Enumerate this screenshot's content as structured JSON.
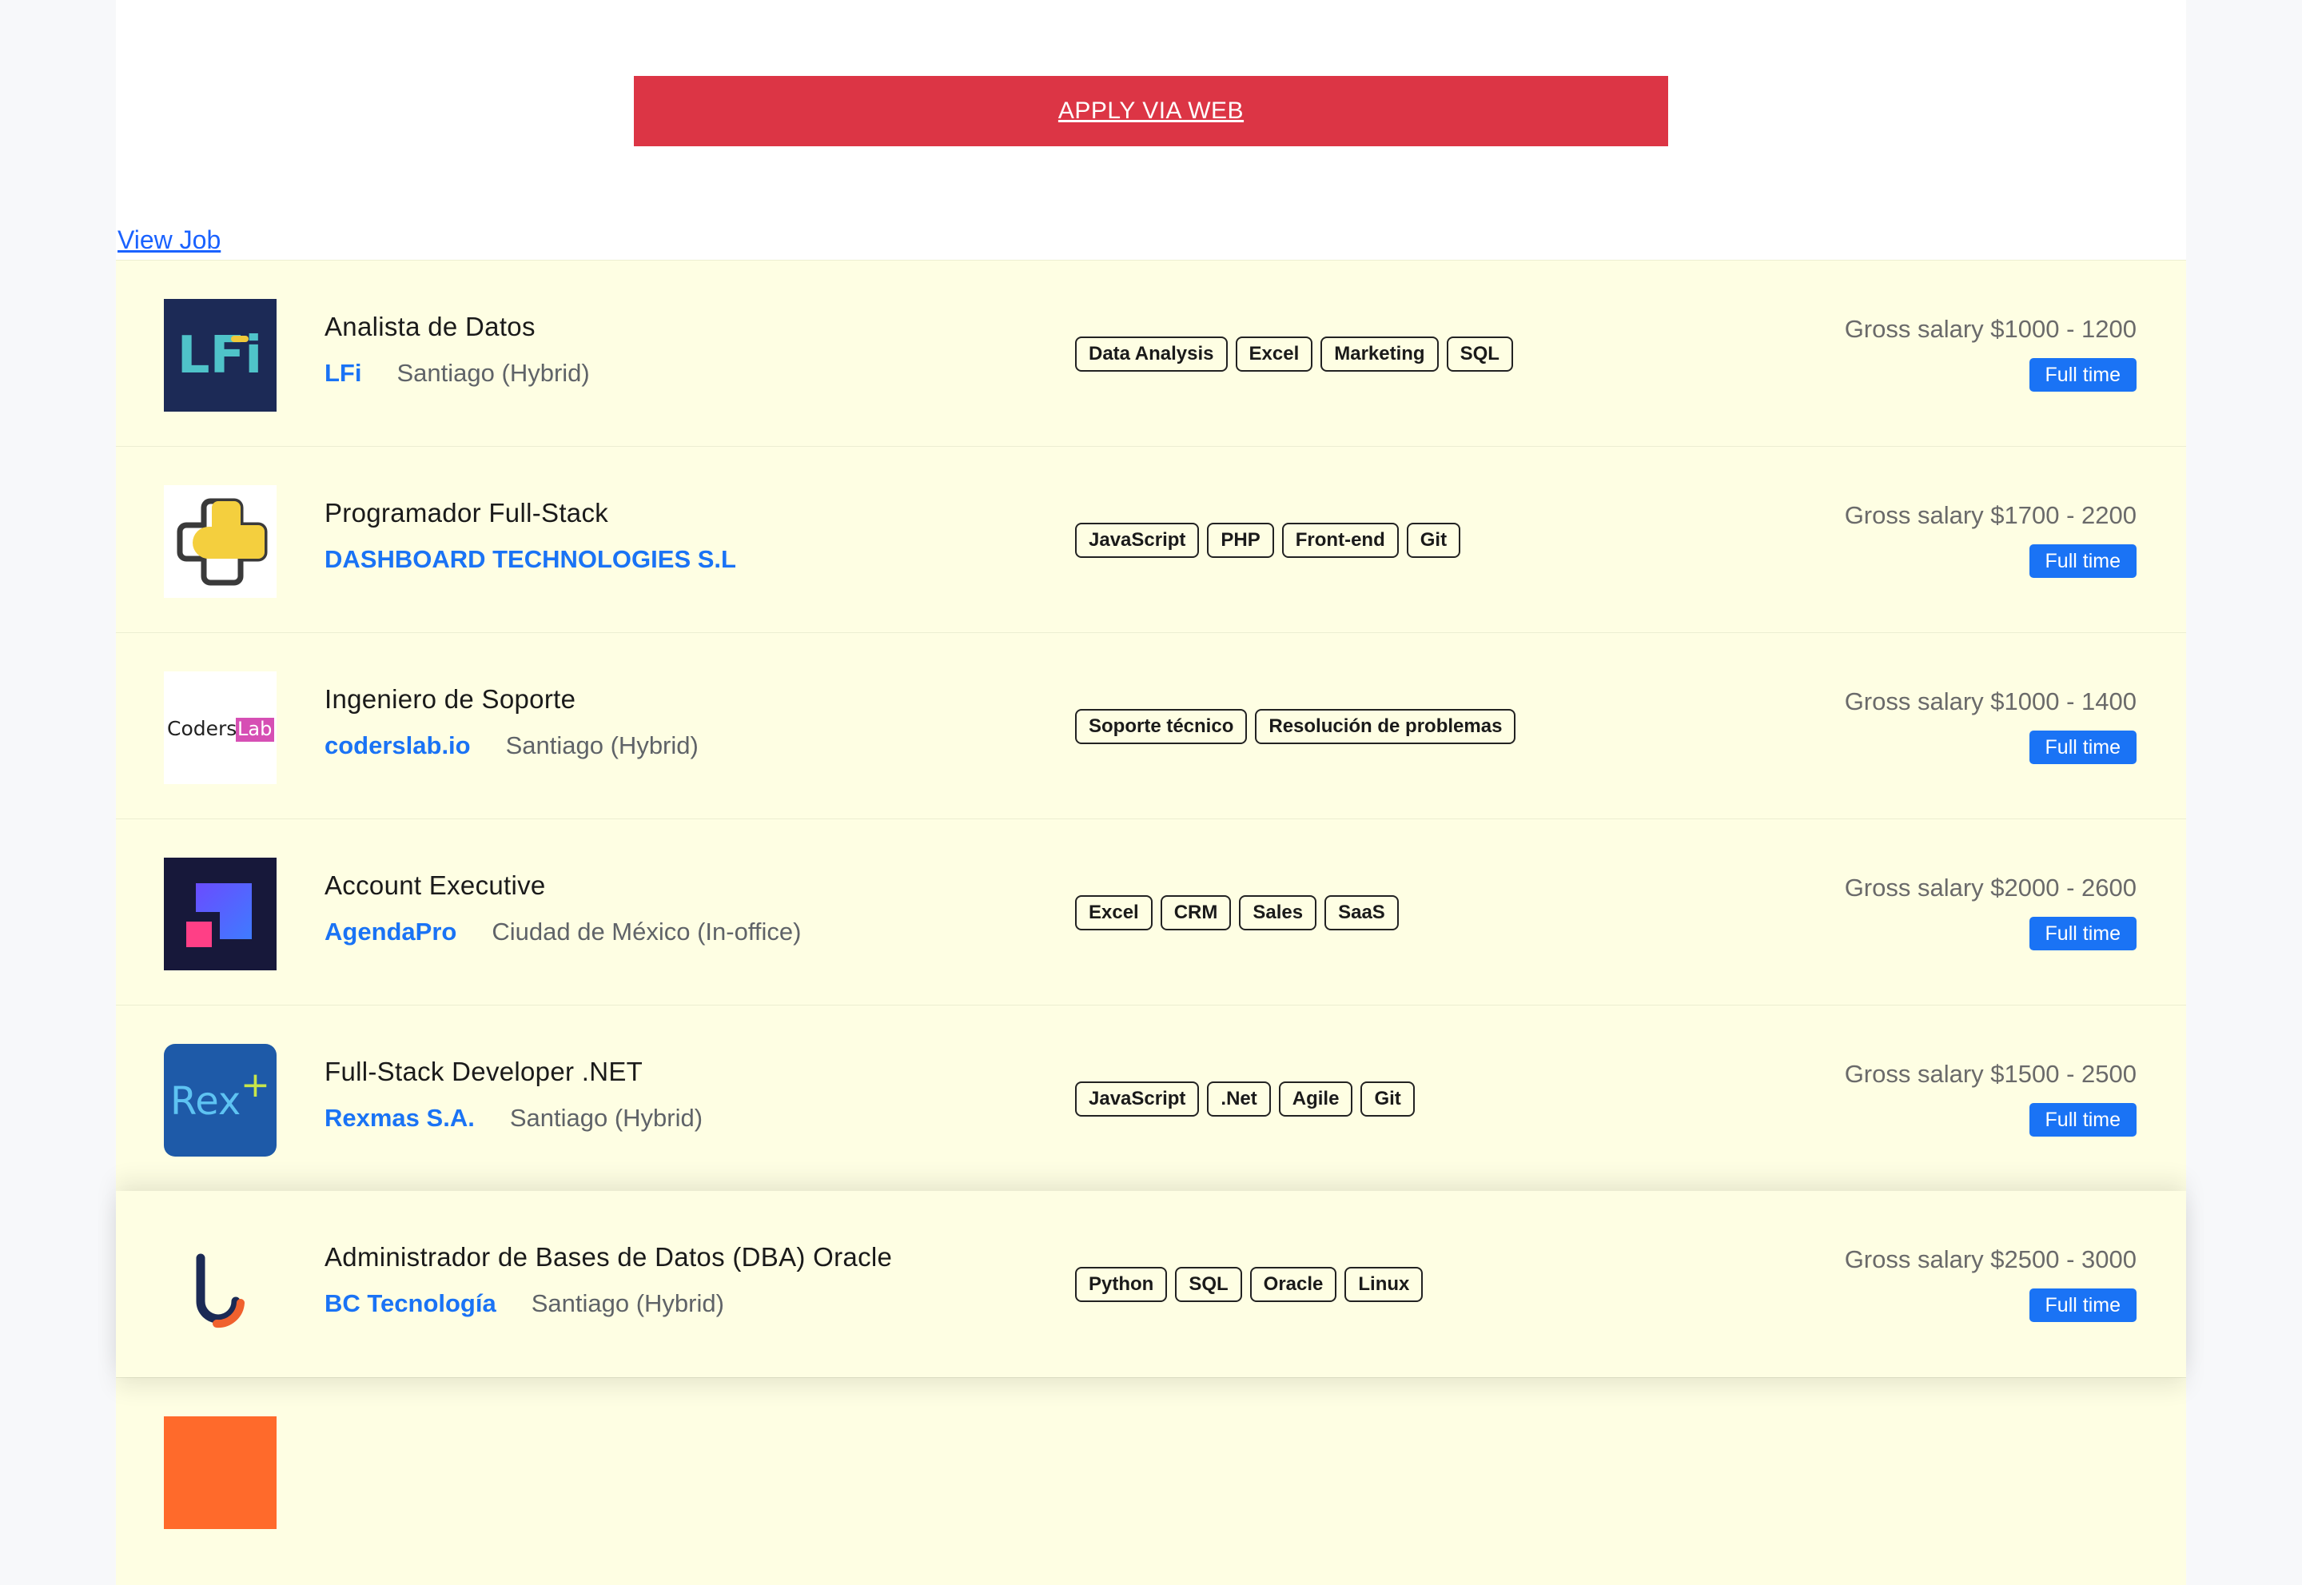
{
  "apply_button": {
    "label": "APPLY VIA WEB"
  },
  "view_job": {
    "label": "View Job"
  },
  "colors": {
    "apply_bg": "#dc3545",
    "row_bg": "#fefee3",
    "company_link": "#1a73f5",
    "badge_bg": "#1a73f5"
  },
  "jobs": [
    {
      "title": "Analista de Datos",
      "company": "LFi",
      "location": "Santiago (Hybrid)",
      "tags": [
        "Data Analysis",
        "Excel",
        "Marketing",
        "SQL"
      ],
      "salary": "Gross salary $1000 - 1200",
      "type": "Full time",
      "logo": "lfi-logo",
      "logo_text": "LFi"
    },
    {
      "title": "Programador Full-Stack",
      "company": "DASHBOARD TECHNOLOGIES S.L",
      "location": "",
      "tags": [
        "JavaScript",
        "PHP",
        "Front-end",
        "Git"
      ],
      "salary": "Gross salary $1700 - 2200",
      "type": "Full time",
      "logo": "dashboard-logo"
    },
    {
      "title": "Ingeniero de Soporte",
      "company": "coderslab.io",
      "location": "Santiago (Hybrid)",
      "tags": [
        "Soporte técnico",
        "Resolución de problemas"
      ],
      "salary": "Gross salary $1000 - 1400",
      "type": "Full time",
      "logo": "coderslab-logo",
      "logo_text": "Coders",
      "logo_text_accent": "Lab"
    },
    {
      "title": "Account Executive",
      "company": "AgendaPro",
      "location": "Ciudad de México (In-office)",
      "tags": [
        "Excel",
        "CRM",
        "Sales",
        "SaaS"
      ],
      "salary": "Gross salary $2000 - 2600",
      "type": "Full time",
      "logo": "agendapro-logo"
    },
    {
      "title": "Full-Stack Developer .NET",
      "company": "Rexmas S.A.",
      "location": "Santiago (Hybrid)",
      "tags": [
        "JavaScript",
        ".Net",
        "Agile",
        "Git"
      ],
      "salary": "Gross salary $1500 - 2500",
      "type": "Full time",
      "logo": "rexmas-logo",
      "logo_text": "Rex",
      "logo_text_accent": "+"
    },
    {
      "title": "Administrador de Bases de Datos (DBA) Oracle",
      "company": "BC Tecnología",
      "location": "Santiago (Hybrid)",
      "tags": [
        "Python",
        "SQL",
        "Oracle",
        "Linux"
      ],
      "salary": "Gross salary $2500 - 3000",
      "type": "Full time",
      "logo": "bc-tecnologia-logo"
    }
  ]
}
